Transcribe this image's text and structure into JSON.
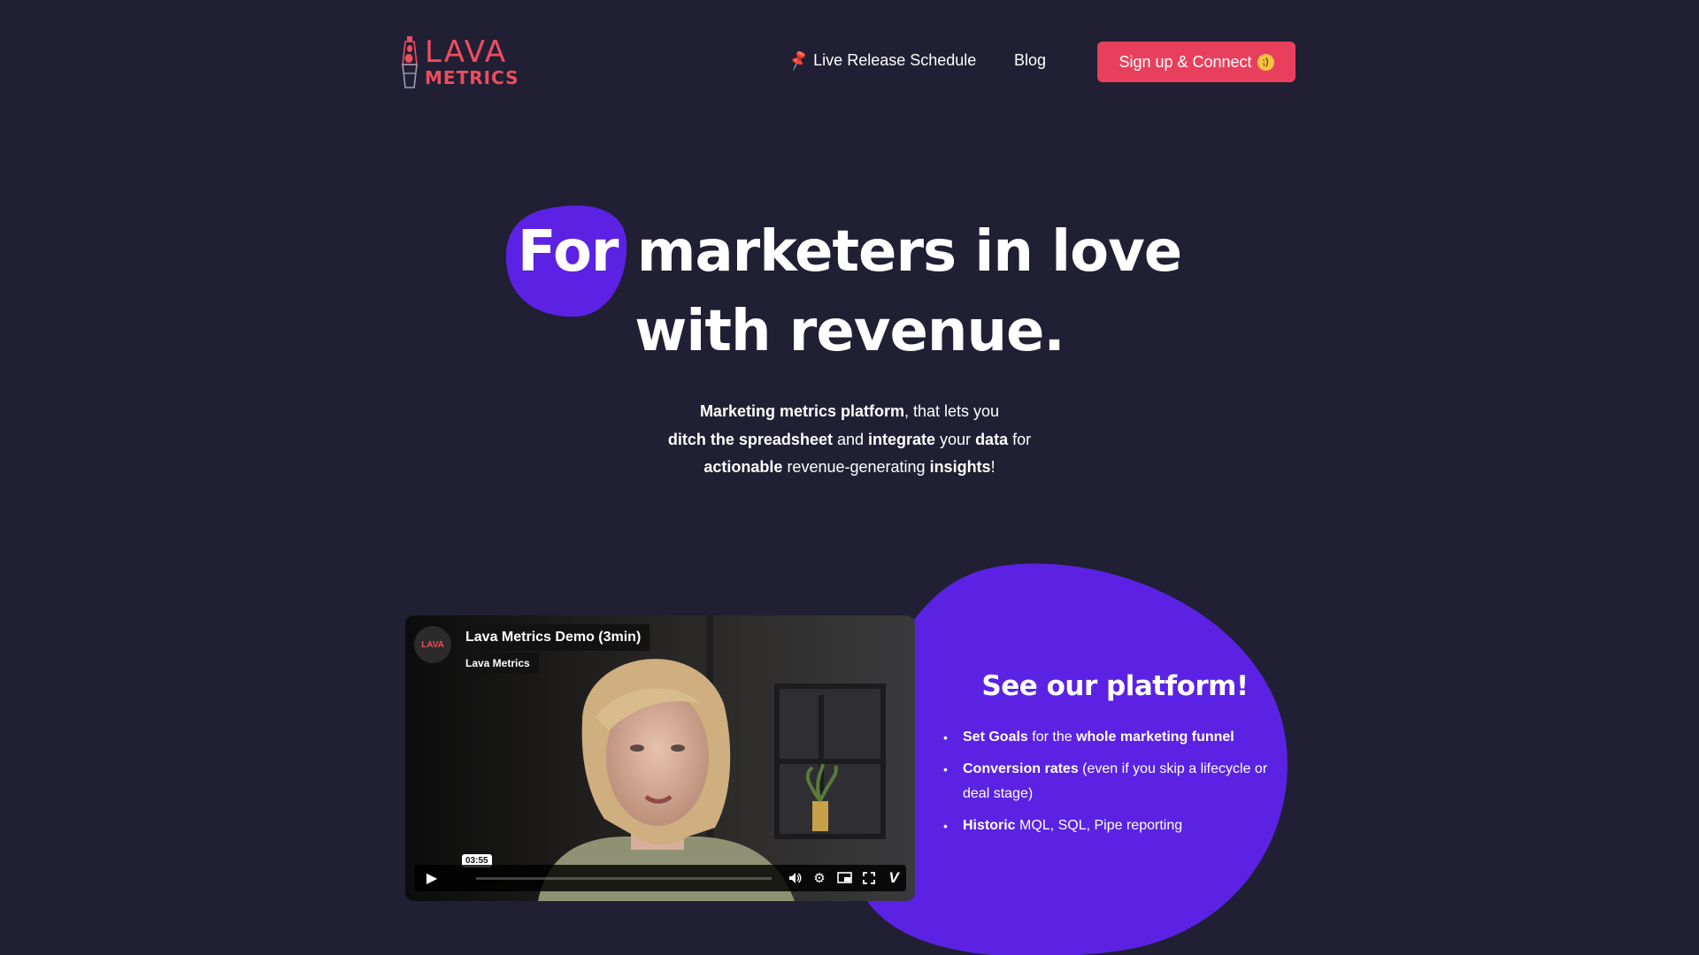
{
  "nav": {
    "logo_line1": "LAVA",
    "logo_line2": "METRICS",
    "release_label": "Live Release Schedule",
    "blog_label": "Blog",
    "signup_label": "Sign up & Connect"
  },
  "hero": {
    "title_line1": "For marketers in love",
    "title_line2": "with revenue.",
    "sub1_bold": "Marketing metrics platform",
    "sub1_rest": ", that lets you",
    "sub2_bold1": "ditch the spreadsheet",
    "sub2_mid": " and ",
    "sub2_bold2": "integrate",
    "sub2_mid2": " your ",
    "sub2_bold3": "data",
    "sub2_end": " for",
    "sub3_bold1": "actionable",
    "sub3_mid": " revenue-generating ",
    "sub3_bold2": "insights",
    "sub3_end": "!"
  },
  "video": {
    "title": "Lava Metrics Demo (3min)",
    "owner": "Lava Metrics",
    "avatar_text": "LAVA",
    "time": "03:55",
    "progress": 0
  },
  "platform": {
    "title": "See our platform!",
    "items": [
      {
        "bold": "Set Goals",
        "mid": " for the ",
        "bold2": "whole marketing funnel",
        "rest": ""
      },
      {
        "bold": "Conversion rates",
        "mid": " (even if you skip a lifecycle or deal stage)",
        "bold2": "",
        "rest": ""
      },
      {
        "bold": "Historic",
        "mid": " MQL, SQL, Pipe reporting",
        "bold2": "",
        "rest": ""
      }
    ]
  },
  "colors": {
    "background": "#211f33",
    "brand_coral": "#e8405c",
    "accent_purple": "#5b22e4"
  },
  "icons": {
    "pin": "pushpin-icon",
    "wink": "winking-face-icon",
    "play": "play-icon",
    "volume": "volume-icon",
    "settings": "gear-icon",
    "pip": "picture-in-picture-icon",
    "fullscreen": "fullscreen-icon",
    "vimeo": "vimeo-logo-icon"
  }
}
